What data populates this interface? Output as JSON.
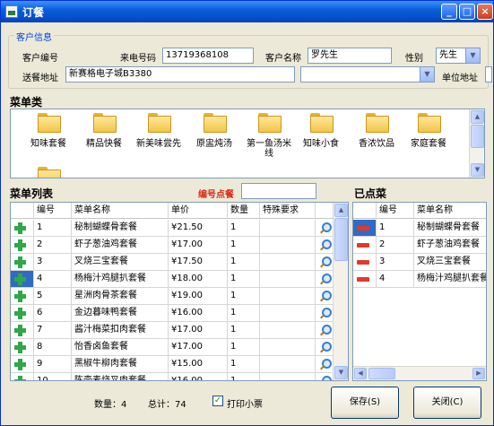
{
  "window": {
    "title": "订餐"
  },
  "customer": {
    "legend": "客户信息",
    "id_label": "客户编号",
    "phone_label": "来电号码",
    "phone_value": "13719368108",
    "name_label": "客户名称",
    "name_value": "罗先生",
    "gender_label": "性别",
    "gender_value": "先生",
    "address_label": "送餐地址",
    "address_value": "新赛格电子城B3380",
    "unit_label": "单位地址"
  },
  "categories": {
    "title": "菜单类",
    "items": [
      "知味套餐",
      "精品快餐",
      "新美味尝先",
      "原盅炖汤",
      "第一鱼汤米线",
      "知味小食",
      "香浓饮品",
      "家庭套餐",
      ""
    ]
  },
  "menu": {
    "title": "菜单列表",
    "code_label": "编号点餐",
    "columns": [
      "编号",
      "菜单名称",
      "单价",
      "数量",
      "特殊要求"
    ],
    "rows": [
      {
        "no": "1",
        "name": "秘制蝴蝶骨套餐",
        "price": "¥21.50",
        "qty": "1",
        "note": ""
      },
      {
        "no": "2",
        "name": "虾子葱油鸡套餐",
        "price": "¥17.00",
        "qty": "1",
        "note": ""
      },
      {
        "no": "3",
        "name": "叉烧三宝套餐",
        "price": "¥17.50",
        "qty": "1",
        "note": ""
      },
      {
        "no": "4",
        "name": "杨梅汁鸡腿扒套餐",
        "price": "¥18.00",
        "qty": "1",
        "note": ""
      },
      {
        "no": "5",
        "name": "星洲肉骨茶套餐",
        "price": "¥19.00",
        "qty": "1",
        "note": ""
      },
      {
        "no": "6",
        "name": "金边暮味鸭套餐",
        "price": "¥16.00",
        "qty": "1",
        "note": ""
      },
      {
        "no": "7",
        "name": "酱汁梅菜扣肉套餐",
        "price": "¥17.00",
        "qty": "1",
        "note": ""
      },
      {
        "no": "8",
        "name": "怡香卤鱼套餐",
        "price": "¥17.00",
        "qty": "1",
        "note": ""
      },
      {
        "no": "9",
        "name": "黑椒牛柳肉套餐",
        "price": "¥15.00",
        "qty": "1",
        "note": ""
      },
      {
        "no": "10",
        "name": "陈壶麦烧叉肉套餐",
        "price": "¥16.00",
        "qty": "1",
        "note": ""
      }
    ]
  },
  "ordered": {
    "title": "已点菜",
    "columns": [
      "编号",
      "菜单名称"
    ],
    "rows": [
      {
        "no": "1",
        "name": "秘制蝴蝶骨套餐"
      },
      {
        "no": "2",
        "name": "虾子葱油鸡套餐"
      },
      {
        "no": "3",
        "name": "叉烧三宝套餐"
      },
      {
        "no": "4",
        "name": "杨梅汁鸡腿扒套餐"
      }
    ]
  },
  "footer": {
    "count_label": "数量：4",
    "total_label": "总计：74",
    "print_label": "打印小票",
    "save_label": "保存(S)",
    "close_label": "关闭(C)"
  },
  "colors": {
    "accent_red": "#d62b17",
    "legend_blue": "#0046d5",
    "title_blue": "#0a5fd7"
  }
}
